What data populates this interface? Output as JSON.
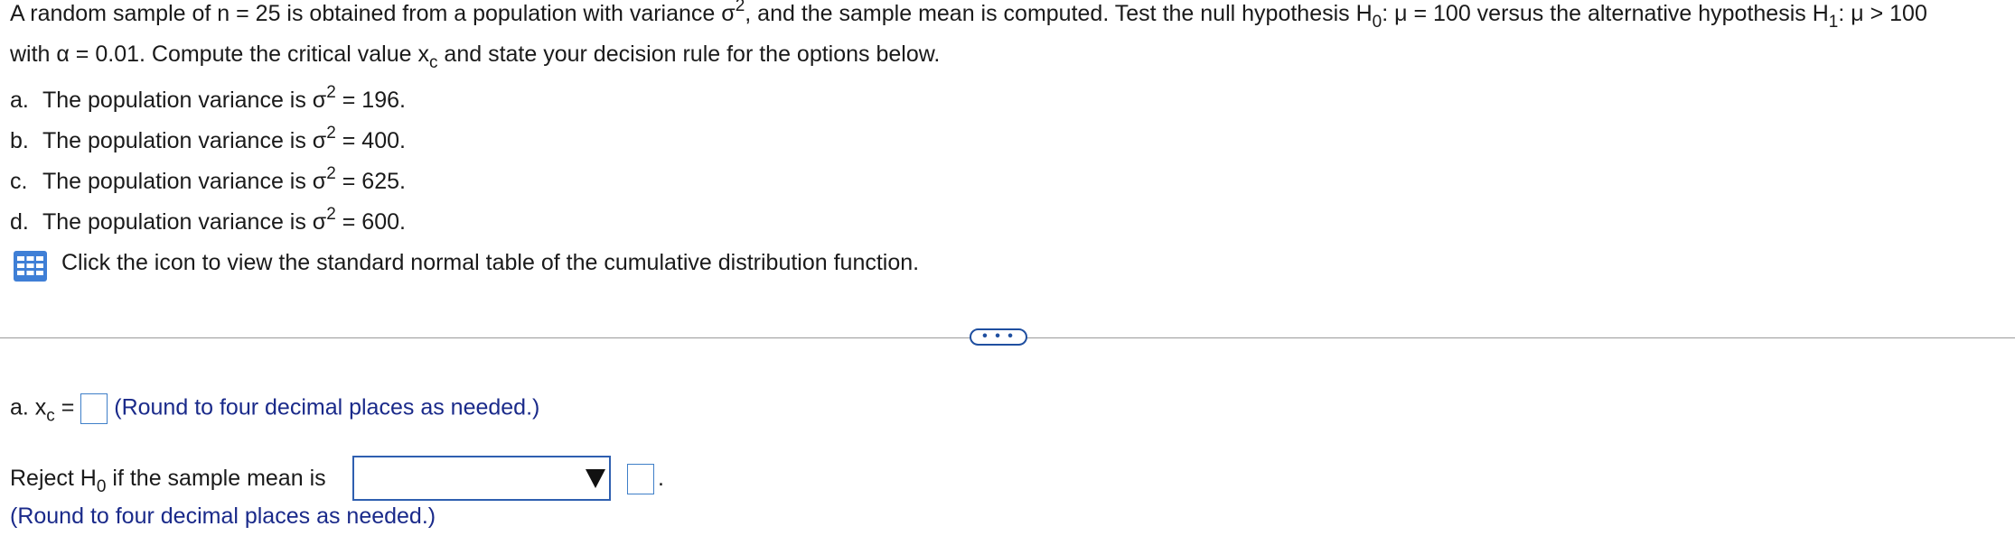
{
  "question": {
    "line1_part1": "A random sample of n = 25 is obtained from a population with variance σ",
    "line1_sigma_sup": "2",
    "line1_part2": ", and the sample mean is computed. Test the null hypothesis H",
    "h0_sub": "0",
    "line1_part3": ": μ = 100 versus the alternative hypothesis H",
    "h1_sub": "1",
    "line1_part4": ": μ > 100",
    "line2_part1": "with α = 0.01. Compute the critical value x",
    "xc_sub": "c",
    "line2_part2": " and state your decision rule for the options below."
  },
  "options": [
    {
      "letter": "a.",
      "text": "The population variance is σ",
      "sup": "2",
      "value": " = 196."
    },
    {
      "letter": "b.",
      "text": "The population variance is σ",
      "sup": "2",
      "value": " = 400."
    },
    {
      "letter": "c.",
      "text": "The population variance is σ",
      "sup": "2",
      "value": " = 625."
    },
    {
      "letter": "d.",
      "text": "The population variance is σ",
      "sup": "2",
      "value": " = 600."
    }
  ],
  "table_link": {
    "text": "Click the icon to view the standard normal table of the cumulative distribution function.",
    "icon": "table-grid-icon"
  },
  "more_button": {
    "label": "• • •"
  },
  "answer": {
    "label_prefix": "a. x",
    "label_sub": "c",
    "label_eq": " =",
    "value": "",
    "hint": "(Round to four decimal places as needed.)",
    "reject_prefix": "Reject H",
    "reject_sub": "0",
    "reject_suffix": " if the sample mean is",
    "select_value": "",
    "critical_value": "",
    "period": ".",
    "hint2": "(Round to four decimal places as needed.)"
  },
  "colors": {
    "accent": "#2f5fb0",
    "hint": "#1a2a8a",
    "icon_blue": "#3f7fd6"
  }
}
